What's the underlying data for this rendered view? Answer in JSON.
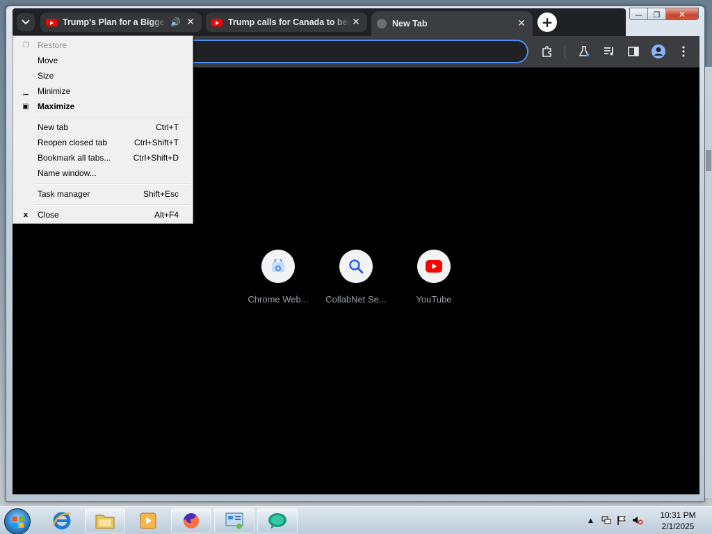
{
  "window": {
    "caption_buttons": {
      "minimize": "—",
      "restore": "❐",
      "close": "✕"
    }
  },
  "tabs": [
    {
      "title": "Trump's Plan for a Bigger America",
      "favicon": "youtube-icon",
      "audio": true,
      "active": false
    },
    {
      "title": "Trump calls for Canada to become",
      "favicon": "youtube-icon",
      "audio": false,
      "active": false
    },
    {
      "title": "New Tab",
      "favicon": "globe-icon",
      "audio": false,
      "active": true
    }
  ],
  "tab_close_glyph": "✕",
  "new_tab_glyph": "+",
  "toolbar": {
    "omnibox_value": "",
    "icons": [
      "extensions-icon",
      "labs-icon",
      "media-controls-icon",
      "side-panel-icon",
      "profile-icon",
      "more-menu-icon"
    ]
  },
  "shortcuts": [
    {
      "label": "Chrome Web...",
      "icon": "chrome-web-store-icon"
    },
    {
      "label": "CollabNet Se...",
      "icon": "magnifier-icon"
    },
    {
      "label": "YouTube",
      "icon": "youtube-icon"
    }
  ],
  "system_menu": {
    "items": [
      {
        "label": "Restore",
        "accel": "",
        "glyph": "❐",
        "disabled": true,
        "bold": false
      },
      {
        "label": "Move",
        "accel": "",
        "glyph": "",
        "disabled": false,
        "bold": false
      },
      {
        "label": "Size",
        "accel": "",
        "glyph": "",
        "disabled": false,
        "bold": false
      },
      {
        "label": "Minimize",
        "accel": "",
        "glyph": "▁",
        "disabled": false,
        "bold": false
      },
      {
        "label": "Maximize",
        "accel": "",
        "glyph": "▣",
        "disabled": false,
        "bold": true
      },
      {
        "label": "New tab",
        "accel": "Ctrl+T",
        "glyph": "",
        "disabled": false,
        "bold": false
      },
      {
        "label": "Reopen closed tab",
        "accel": "Ctrl+Shift+T",
        "glyph": "",
        "disabled": false,
        "bold": false
      },
      {
        "label": "Bookmark all tabs...",
        "accel": "Ctrl+Shift+D",
        "glyph": "",
        "disabled": false,
        "bold": false
      },
      {
        "label": "Name window...",
        "accel": "",
        "glyph": "",
        "disabled": false,
        "bold": false
      },
      {
        "label": "Task manager",
        "accel": "Shift+Esc",
        "glyph": "",
        "disabled": false,
        "bold": false
      },
      {
        "label": "Close",
        "accel": "Alt+F4",
        "glyph": "x",
        "disabled": false,
        "bold": false
      }
    ]
  },
  "taskbar": {
    "apps": [
      "internet-explorer-icon",
      "file-explorer-icon",
      "media-player-icon",
      "firefox-icon",
      "control-panel-icon",
      "chat-app-icon"
    ],
    "tray_icons": [
      "show-hidden-icons-arrow",
      "network-icon",
      "action-center-flag-icon",
      "volume-muted-icon"
    ],
    "time": "10:31 PM",
    "date": "2/1/2025"
  },
  "colors": {
    "tabstrip": "#202124",
    "toolbar": "#3c3d41",
    "omnibox_focus": "#4e8df5",
    "content_bg": "#000000",
    "youtube_red": "#ff0000",
    "menu_bg": "#f0f0f0"
  }
}
